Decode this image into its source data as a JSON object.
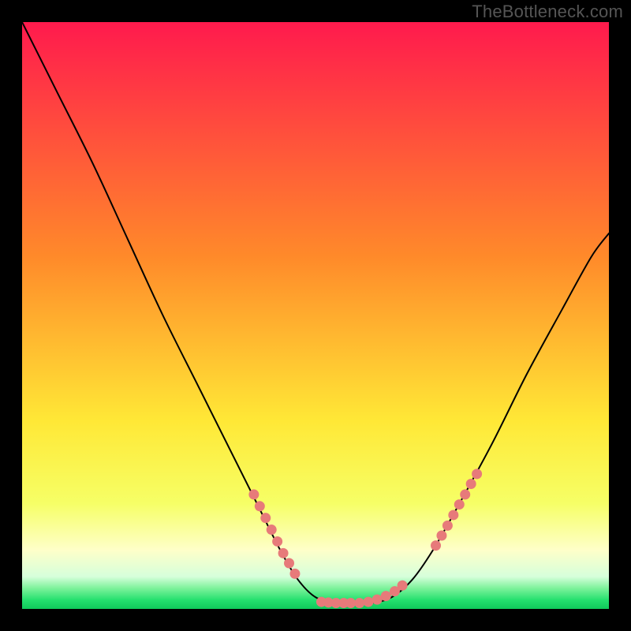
{
  "watermark": "TheBottleneck.com",
  "colors": {
    "frame": "#000000",
    "curve": "#000000",
    "dots": "#e77a7a",
    "gradient_stops": [
      {
        "offset": 0.0,
        "color": "#ff1a4d"
      },
      {
        "offset": 0.4,
        "color": "#ff8a2a"
      },
      {
        "offset": 0.68,
        "color": "#ffe836"
      },
      {
        "offset": 0.82,
        "color": "#f6ff66"
      },
      {
        "offset": 0.9,
        "color": "#feffc9"
      },
      {
        "offset": 0.945,
        "color": "#d6ffdb"
      },
      {
        "offset": 0.965,
        "color": "#7cf29a"
      },
      {
        "offset": 0.985,
        "color": "#24e06e"
      },
      {
        "offset": 1.0,
        "color": "#0fc95b"
      }
    ]
  },
  "chart_data": {
    "type": "line",
    "title": "",
    "xlabel": "",
    "ylabel": "",
    "xlim": [
      0,
      1
    ],
    "ylim": [
      0,
      1
    ],
    "note": "Axis values are normalized estimates; x represents some swept parameter, y represents bottleneck/mismatch (0 = optimal at the green band, 1 = worst at top).",
    "series": [
      {
        "name": "bottleneck-curve",
        "x": [
          0.0,
          0.06,
          0.12,
          0.18,
          0.24,
          0.3,
          0.36,
          0.4,
          0.44,
          0.47,
          0.5,
          0.535,
          0.565,
          0.595,
          0.63,
          0.665,
          0.7,
          0.74,
          0.8,
          0.86,
          0.92,
          0.97,
          1.0
        ],
        "y": [
          1.0,
          0.88,
          0.76,
          0.63,
          0.5,
          0.38,
          0.26,
          0.18,
          0.1,
          0.05,
          0.02,
          0.01,
          0.01,
          0.01,
          0.02,
          0.05,
          0.1,
          0.17,
          0.28,
          0.4,
          0.51,
          0.6,
          0.64
        ]
      }
    ],
    "dots": {
      "name": "highlighted-points",
      "note": "Pink dotted segments on left descent, flat valley, and right ascent",
      "points": [
        {
          "x": 0.395,
          "y": 0.195
        },
        {
          "x": 0.405,
          "y": 0.175
        },
        {
          "x": 0.415,
          "y": 0.155
        },
        {
          "x": 0.425,
          "y": 0.135
        },
        {
          "x": 0.435,
          "y": 0.115
        },
        {
          "x": 0.445,
          "y": 0.095
        },
        {
          "x": 0.455,
          "y": 0.078
        },
        {
          "x": 0.465,
          "y": 0.06
        },
        {
          "x": 0.51,
          "y": 0.012
        },
        {
          "x": 0.522,
          "y": 0.011
        },
        {
          "x": 0.535,
          "y": 0.01
        },
        {
          "x": 0.548,
          "y": 0.01
        },
        {
          "x": 0.56,
          "y": 0.01
        },
        {
          "x": 0.575,
          "y": 0.01
        },
        {
          "x": 0.59,
          "y": 0.012
        },
        {
          "x": 0.605,
          "y": 0.016
        },
        {
          "x": 0.62,
          "y": 0.022
        },
        {
          "x": 0.635,
          "y": 0.03
        },
        {
          "x": 0.648,
          "y": 0.04
        },
        {
          "x": 0.705,
          "y": 0.108
        },
        {
          "x": 0.715,
          "y": 0.125
        },
        {
          "x": 0.725,
          "y": 0.142
        },
        {
          "x": 0.735,
          "y": 0.16
        },
        {
          "x": 0.745,
          "y": 0.178
        },
        {
          "x": 0.755,
          "y": 0.195
        },
        {
          "x": 0.765,
          "y": 0.213
        },
        {
          "x": 0.775,
          "y": 0.23
        }
      ]
    }
  }
}
